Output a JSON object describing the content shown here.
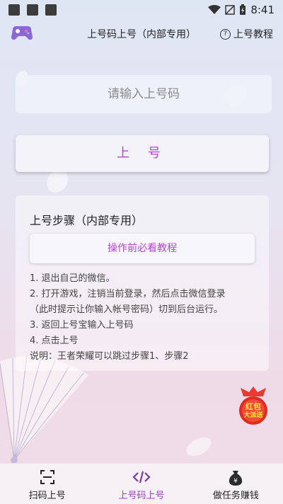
{
  "status_bar": {
    "time": "8:41"
  },
  "header": {
    "title": "上号码上号（内部专用）",
    "help_label": "上号教程"
  },
  "form": {
    "placeholder": "请输入上号码",
    "login_label": "上 号"
  },
  "steps_card": {
    "title": "上号步骤（内部专用）",
    "tutorial_button": "操作前必看教程",
    "lines": [
      "1. 退出自己的微信。",
      "2. 打开游戏，注销当前登录，然后点击微信登录",
      "（此时提示让你输入帐号密码）切到后台运行。",
      "3. 返回上号宝输入上号码",
      "4. 点击上号",
      "说明：王者荣耀可以跳过步骤1、步骤2"
    ]
  },
  "red_packet": {
    "line1": "红包",
    "line2": "大派送"
  },
  "nav": {
    "items": [
      {
        "label": "扫码上号",
        "icon": "scan-icon",
        "active": false
      },
      {
        "label": "上号码上号",
        "icon": "code-icon",
        "active": true
      },
      {
        "label": "做任务赚钱",
        "icon": "money-bag-icon",
        "active": false
      }
    ]
  },
  "colors": {
    "accent": "#b544d2",
    "nav_active": "#9b3fc3"
  }
}
